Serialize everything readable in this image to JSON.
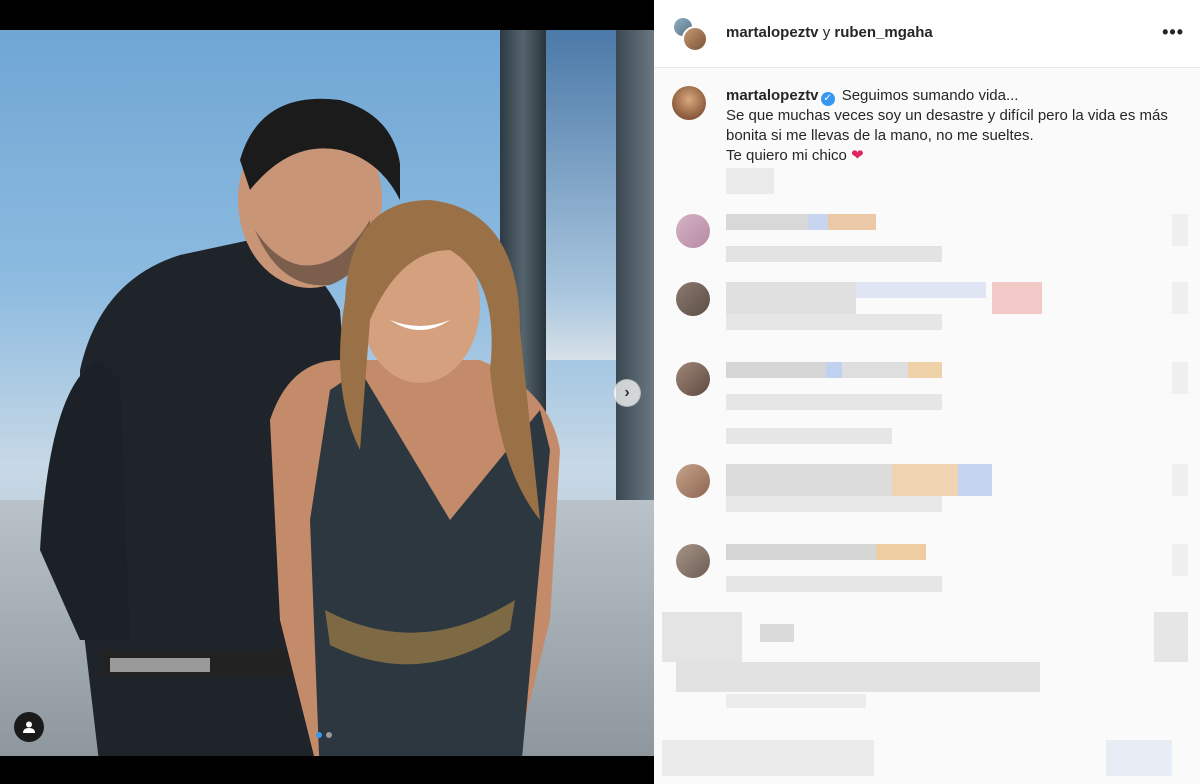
{
  "post": {
    "header": {
      "author": "martalopeztv",
      "joiner": "y",
      "coauthor": "ruben_mgaha",
      "more_label": "•••"
    },
    "caption": {
      "username": "martalopeztv",
      "lines": [
        "Seguimos sumando vida...",
        "Se que muchas veces soy un desastre y difícil pero la vida es más bonita si me llevas de la mano, no me sueltes.",
        "Te quiero mi chico"
      ],
      "emoji": "❤"
    },
    "carousel": {
      "next_label": "›",
      "dot_count": 2,
      "active_dot": 0
    }
  },
  "colors": {
    "accent": "#3897f0",
    "heart": "#e0245e",
    "text": "#262626",
    "pane_bg": "#fafafa"
  }
}
